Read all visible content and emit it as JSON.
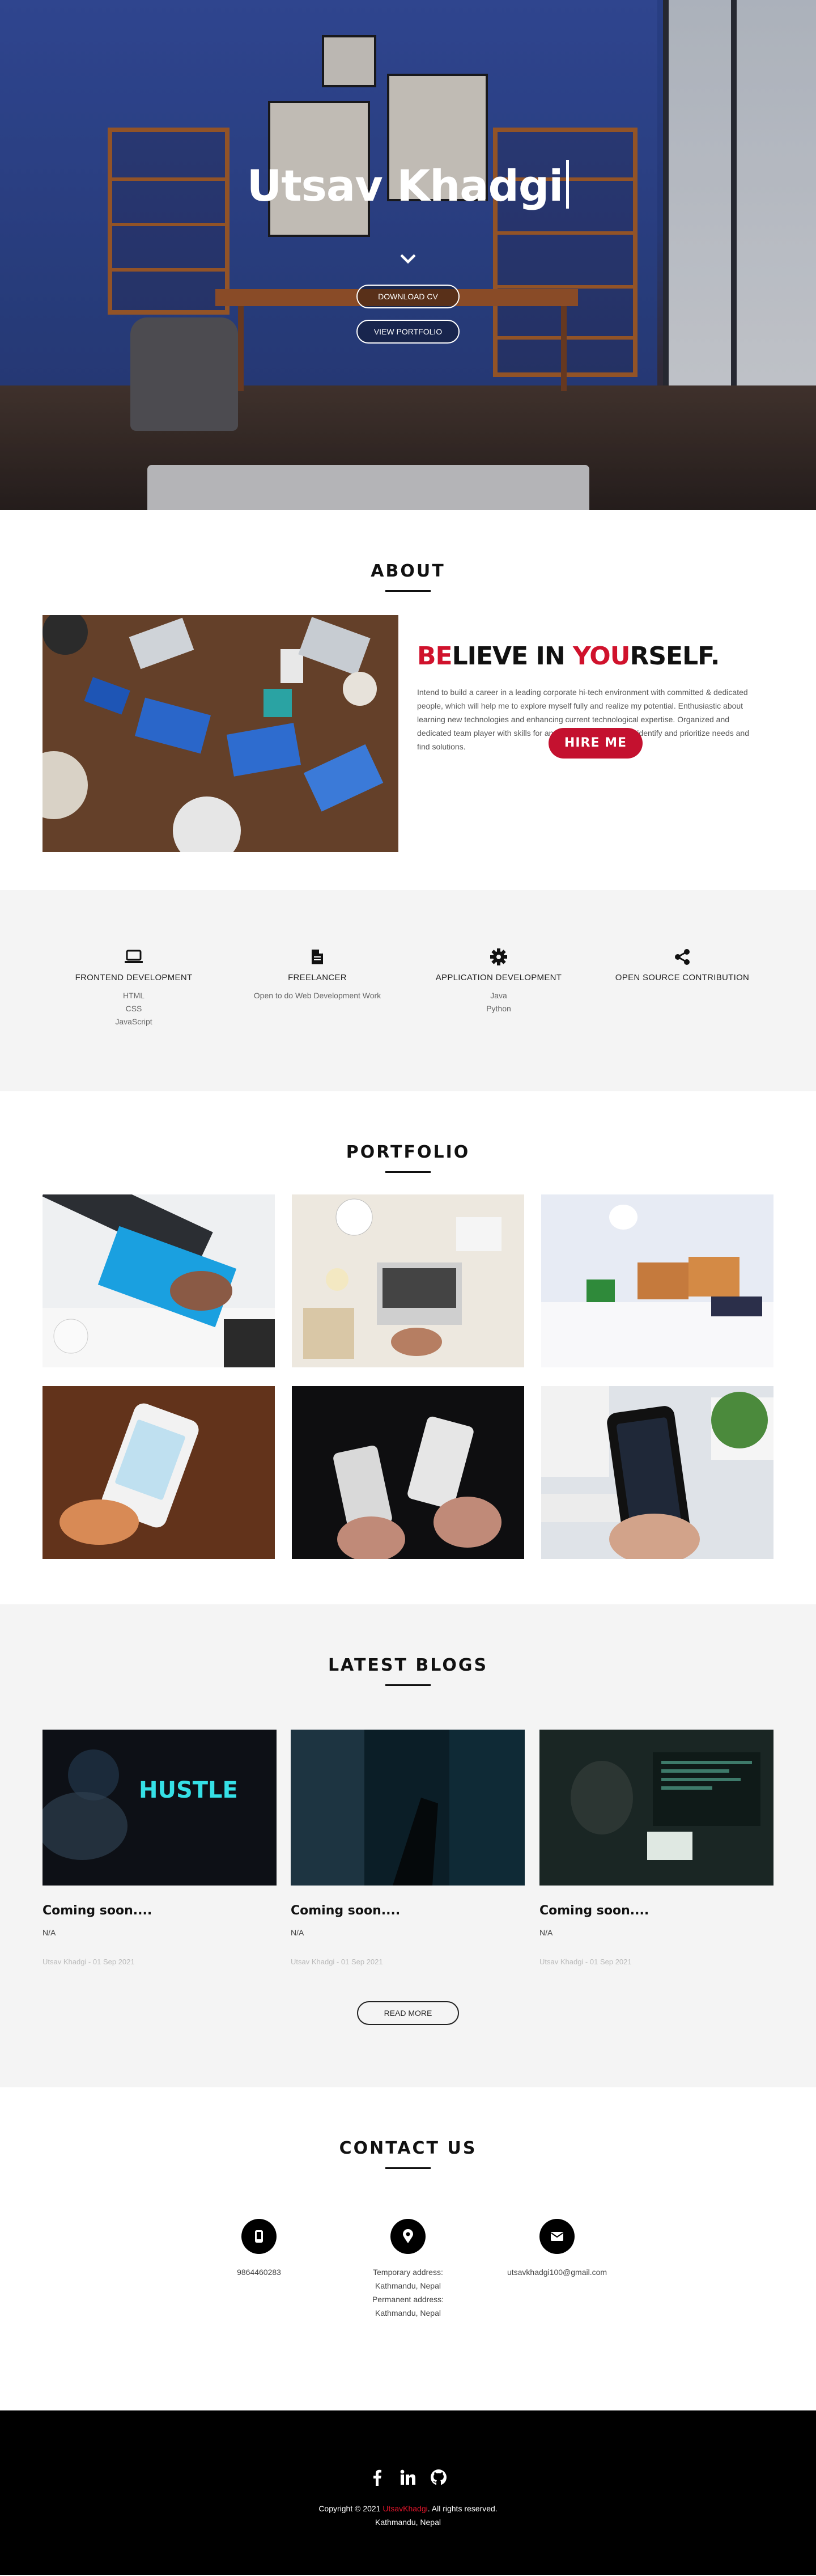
{
  "hero": {
    "name": "Utsav Khadgi",
    "download_cv": "DOWNLOAD CV",
    "view_portfolio": "VIEW PORTFOLIO"
  },
  "about": {
    "title": "ABOUT",
    "heading_be": "BE",
    "heading_lieve_in": "LIEVE IN ",
    "heading_you": "YOU",
    "heading_rself": "RSELF.",
    "text": "Intend to build a career in a leading corporate hi-tech environment with committed & dedicated people, which will help me to explore myself fully and realize my potential. Enthusiastic about learning new technologies and enhancing current technological expertise. Organized and dedicated team player with skills for analyzing the problems to identify and prioritize needs and find solutions.",
    "hire_me": "HIRE ME"
  },
  "services": [
    {
      "name": "FRONTEND DEVELOPMENT",
      "icon": "laptop-icon",
      "items": [
        "HTML",
        "CSS",
        "JavaScript"
      ]
    },
    {
      "name": "FREELANCER",
      "icon": "file-icon",
      "items": [
        "Open to do Web Development Work"
      ]
    },
    {
      "name": "APPLICATION DEVELOPMENT",
      "icon": "gear-icon",
      "items": [
        "Java",
        "Python"
      ]
    },
    {
      "name": "OPEN SOURCE CONTRIBUTION",
      "icon": "share-icon",
      "items": []
    }
  ],
  "portfolio": {
    "title": "PORTFOLIO"
  },
  "blogs": {
    "title": "LATEST BLOGS",
    "hustle_text": "HUSTLE",
    "posts": [
      {
        "title": "Coming soon....",
        "sub": "N/A",
        "meta": "Utsav Khadgi - 01 Sep 2021"
      },
      {
        "title": "Coming soon....",
        "sub": "N/A",
        "meta": "Utsav Khadgi - 01 Sep 2021"
      },
      {
        "title": "Coming soon....",
        "sub": "N/A",
        "meta": "Utsav Khadgi - 01 Sep 2021"
      }
    ],
    "read_more": "READ MORE"
  },
  "contact": {
    "title": "CONTACT US",
    "phone": "9864460283",
    "address_lines": [
      "Temporary address:",
      "Kathmandu, Nepal",
      "Permanent address:",
      "Kathmandu, Nepal"
    ],
    "email": "utsavkhadgi100@gmail.com"
  },
  "footer": {
    "copy_prefix": "Copyright © 2021 ",
    "brand": "UtsavKhadgi",
    "copy_suffix": ". All rights reserved.",
    "location": "Kathmandu, Nepal"
  },
  "colors": {
    "accent": "#c4112f",
    "hero_blue": "#2f4a9a",
    "section_gray": "#f4f4f4"
  }
}
